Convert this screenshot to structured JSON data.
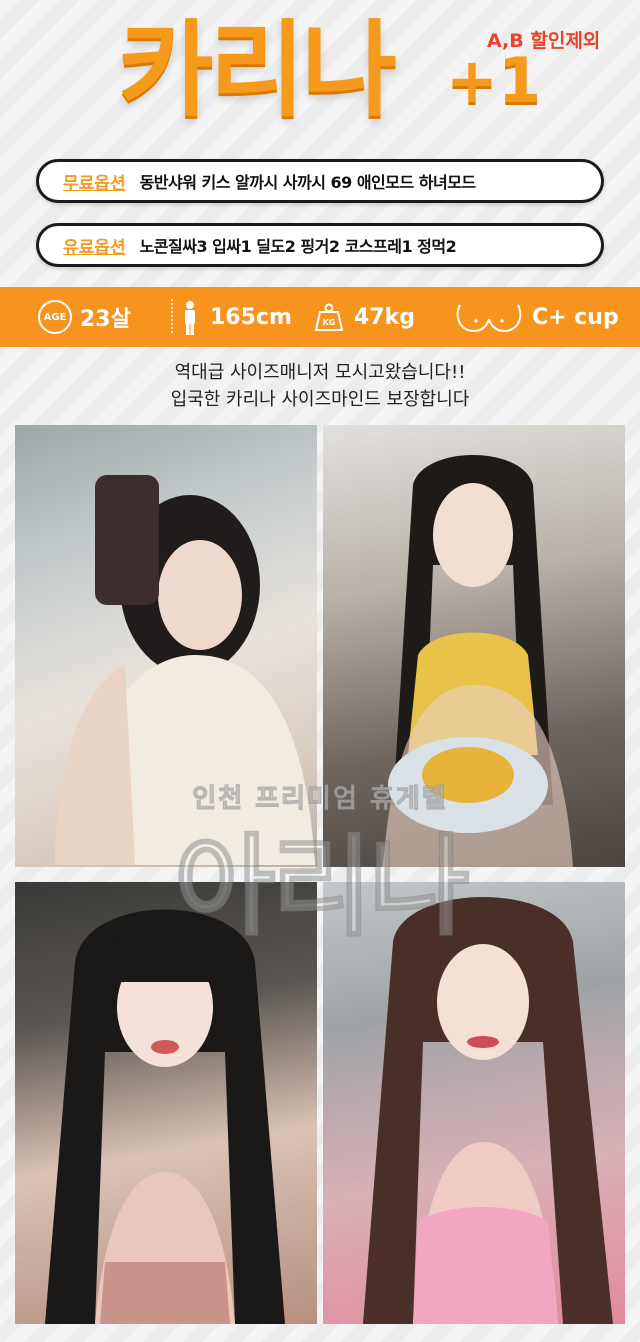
{
  "header": {
    "title": "카리나",
    "plus": "+1",
    "discount_note": "A,B 할인제외"
  },
  "options": {
    "free": {
      "tag": "무료옵션",
      "text": "동반샤워 키스 알까시 사까시 69 애인모드 하녀모드"
    },
    "paid": {
      "tag": "유료옵션",
      "text": "노콘질싸3 입싸1 딜도2 핑거2 코스프레1 정먹2"
    }
  },
  "stats": {
    "age_icon_label": "AGE",
    "age": "23살",
    "height": "165cm",
    "weight_icon_label": "KG",
    "weight": "47kg",
    "cup": "C+ cup",
    "icons": [
      "age-icon",
      "height-icon",
      "weight-icon",
      "bust-icon"
    ]
  },
  "intro": {
    "line1": "역대급 사이즈매니저 모시고왔습니다!!",
    "line2": "입국한 카리나 사이즈마인드 보장합니다"
  },
  "watermark": {
    "line1": "인천 프리미엄 휴게텔",
    "line2": "아리나"
  },
  "colors": {
    "accent": "#f7941d",
    "title": "#f59a1c",
    "discount": "#e8442a",
    "pill_border": "#1a1a1a"
  }
}
